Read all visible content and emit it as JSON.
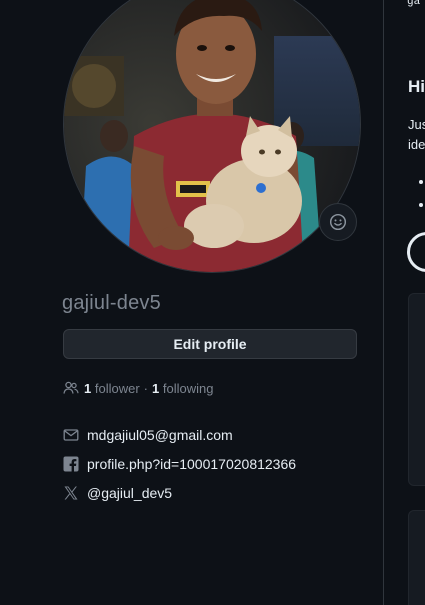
{
  "profile": {
    "username": "gajiul-dev5",
    "edit_button_label": "Edit profile",
    "followers_count": "1",
    "followers_label": "follower",
    "separator": "·",
    "following_count": "1",
    "following_label": "following",
    "email": "mdgajiul05@gmail.com",
    "facebook": "profile.php?id=100017020812366",
    "twitter": "@gajiul_dev5"
  },
  "readme": {
    "top_text": "ga",
    "heading": "Hi",
    "line1": "Jus",
    "line2": "ide"
  },
  "icons": {
    "status": "smiley-icon",
    "people": "people-icon",
    "mail": "mail-icon",
    "facebook": "facebook-icon",
    "x": "x-logo-icon"
  },
  "colors": {
    "background": "#0d1117",
    "muted_text": "#7d8590",
    "text": "#e6edf3",
    "button_bg": "#21262d",
    "border": "#30363d"
  }
}
